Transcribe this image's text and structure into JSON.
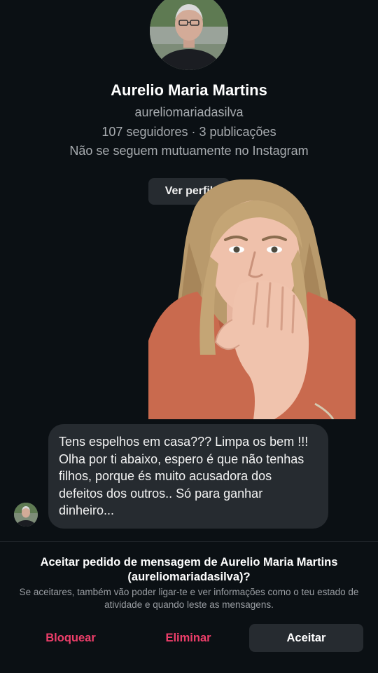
{
  "profile": {
    "name": "Aurelio Maria Martins",
    "username": "aureliomariadasilva",
    "stats": "107 seguidores · 3 publicações",
    "mutual_status": "Não se seguem mutuamente no Instagram",
    "view_profile_label": "Ver perfil"
  },
  "message": {
    "text": "Tens espelhos em casa??? Limpa os bem !!! Olha por ti abaixo, espero é que não tenhas filhos, porque és muito acusadora dos defeitos dos outros.. Só para ganhar dinheiro..."
  },
  "request": {
    "title": "Aceitar pedido de mensagem de Aurelio Maria Martins (aureliomariadasilva)?",
    "description": "Se aceitares, também vão poder ligar-te e ver informações como o teu estado de atividade e quando leste as mensagens.",
    "block_label": "Bloquear",
    "delete_label": "Eliminar",
    "accept_label": "Aceitar"
  },
  "colors": {
    "background": "#0b1014",
    "bubble": "#262b30",
    "destructive": "#ee3e6a",
    "secondary_text": "#a8acb0"
  }
}
